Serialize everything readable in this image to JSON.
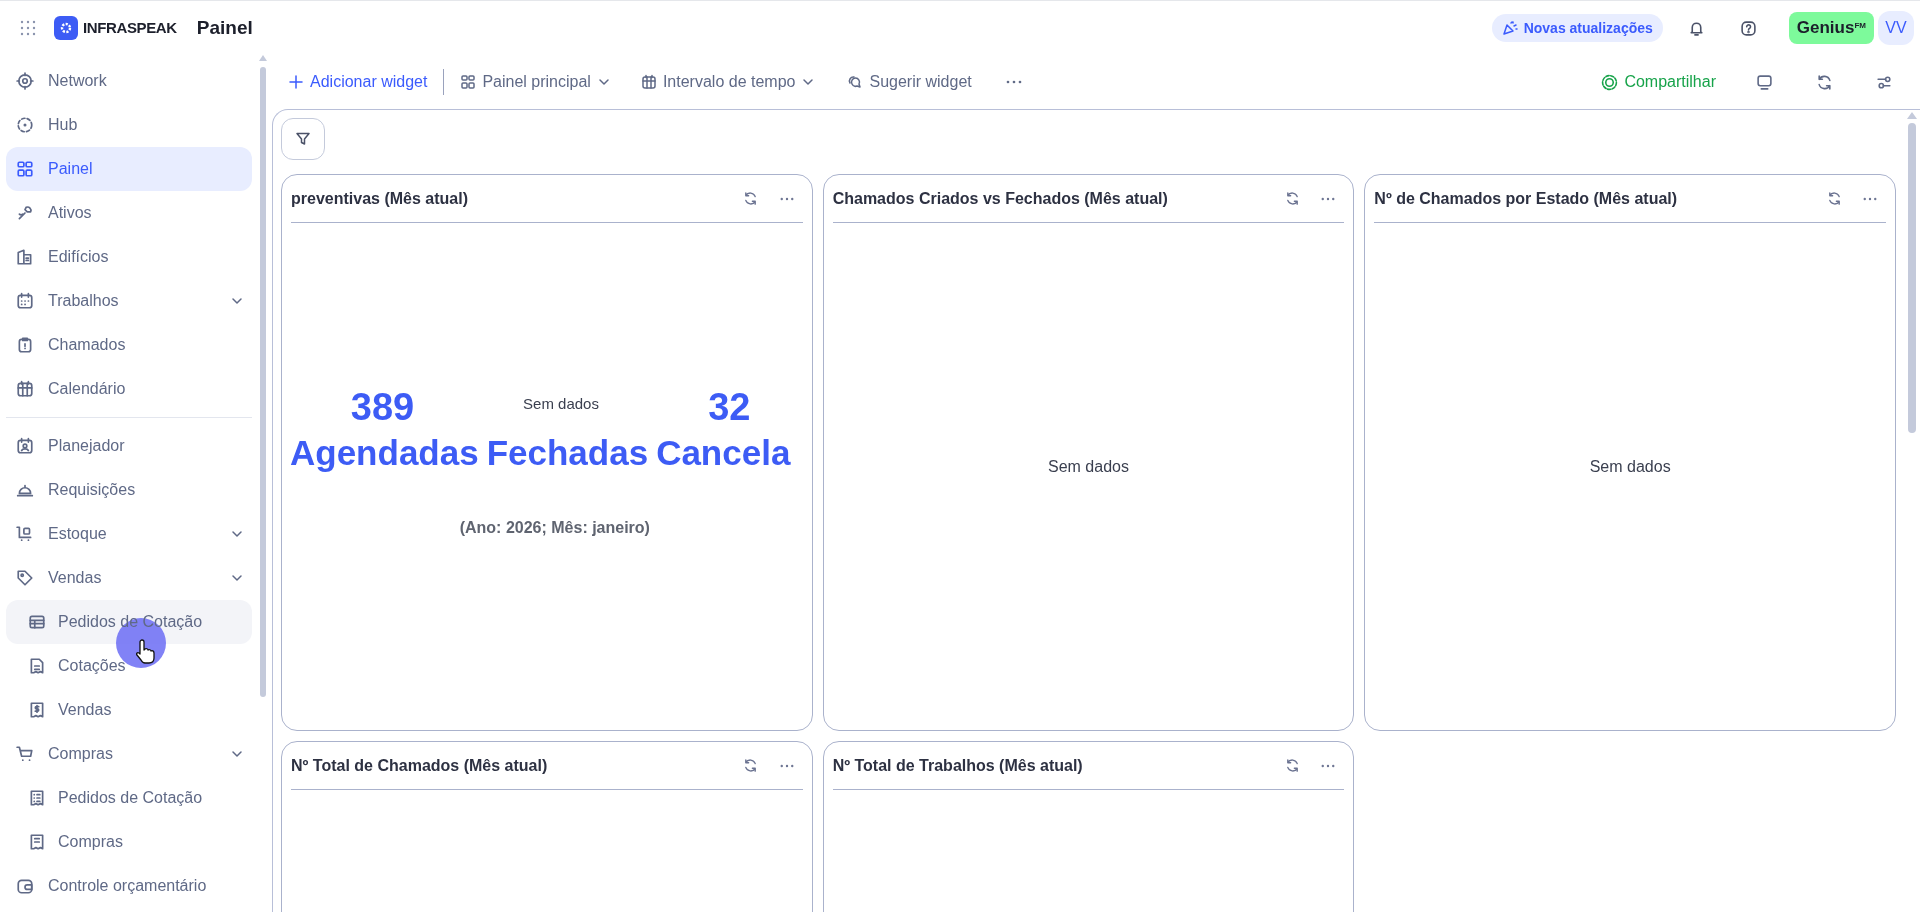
{
  "topbar": {
    "app_name": "INFRASPEAK",
    "page_title": "Painel",
    "updates_button": "Novas atualizações",
    "genius_badge": {
      "text": "Genius",
      "suffix": "FM"
    },
    "avatar": "VV"
  },
  "sidebar": {
    "sections": [
      {
        "items": [
          {
            "label": "Network",
            "selected": false,
            "hovered": false,
            "collapsible": false
          },
          {
            "label": "Hub",
            "selected": false,
            "hovered": false,
            "collapsible": false
          },
          {
            "label": "Painel",
            "selected": true,
            "hovered": false,
            "collapsible": false
          },
          {
            "label": "Ativos",
            "selected": false,
            "hovered": false,
            "collapsible": false
          },
          {
            "label": "Edifícios",
            "selected": false,
            "hovered": false,
            "collapsible": false
          },
          {
            "label": "Trabalhos",
            "selected": false,
            "hovered": false,
            "collapsible": true
          },
          {
            "label": "Chamados",
            "selected": false,
            "hovered": false,
            "collapsible": false
          },
          {
            "label": "Calendário",
            "selected": false,
            "hovered": false,
            "collapsible": false
          }
        ]
      },
      {
        "items": [
          {
            "label": "Planejador",
            "selected": false,
            "hovered": false,
            "collapsible": false
          },
          {
            "label": "Requisições",
            "selected": false,
            "hovered": false,
            "collapsible": false
          },
          {
            "label": "Estoque",
            "selected": false,
            "hovered": false,
            "collapsible": true
          },
          {
            "label": "Vendas",
            "selected": false,
            "hovered": false,
            "collapsible": true,
            "children": [
              {
                "label": "Pedidos de Cotação",
                "selected": false,
                "hovered": true
              },
              {
                "label": "Cotações",
                "selected": false,
                "hovered": false
              },
              {
                "label": "Vendas",
                "selected": false,
                "hovered": false
              }
            ]
          },
          {
            "label": "Compras",
            "selected": false,
            "hovered": false,
            "collapsible": true,
            "children": [
              {
                "label": "Pedidos de Cotação",
                "selected": false,
                "hovered": false
              },
              {
                "label": "Compras",
                "selected": false,
                "hovered": false
              }
            ]
          },
          {
            "label": "Controle orçamentário",
            "selected": false,
            "hovered": false,
            "collapsible": false
          }
        ]
      }
    ]
  },
  "toolbar": {
    "add_widget": "Adicionar widget",
    "dashboard_select": "Painel principal",
    "time_range": "Intervalo de tempo",
    "suggest": "Sugerir widget",
    "share": "Compartilhar"
  },
  "widgets": [
    {
      "title": "preventivas (Mês atual)",
      "kind": "kpi",
      "kpis": [
        {
          "kind": "number",
          "value": "389",
          "label": "Agendadas"
        },
        {
          "kind": "empty",
          "value": "Sem dados",
          "label": "Fechadas"
        },
        {
          "kind": "number",
          "value": "32",
          "label": "Cancela"
        }
      ],
      "caption": "(Ano: 2026; Mês: janeiro)"
    },
    {
      "title": "Chamados Criados vs Fechados (Mês atual)",
      "kind": "empty",
      "message": "Sem dados"
    },
    {
      "title": "Nº de Chamados por Estado (Mês atual)",
      "kind": "empty",
      "message": "Sem dados"
    },
    {
      "title": "Nº Total de Chamados (Mês atual)",
      "kind": "pending"
    },
    {
      "title": "Nº Total de Trabalhos (Mês atual)",
      "kind": "pending"
    }
  ]
}
